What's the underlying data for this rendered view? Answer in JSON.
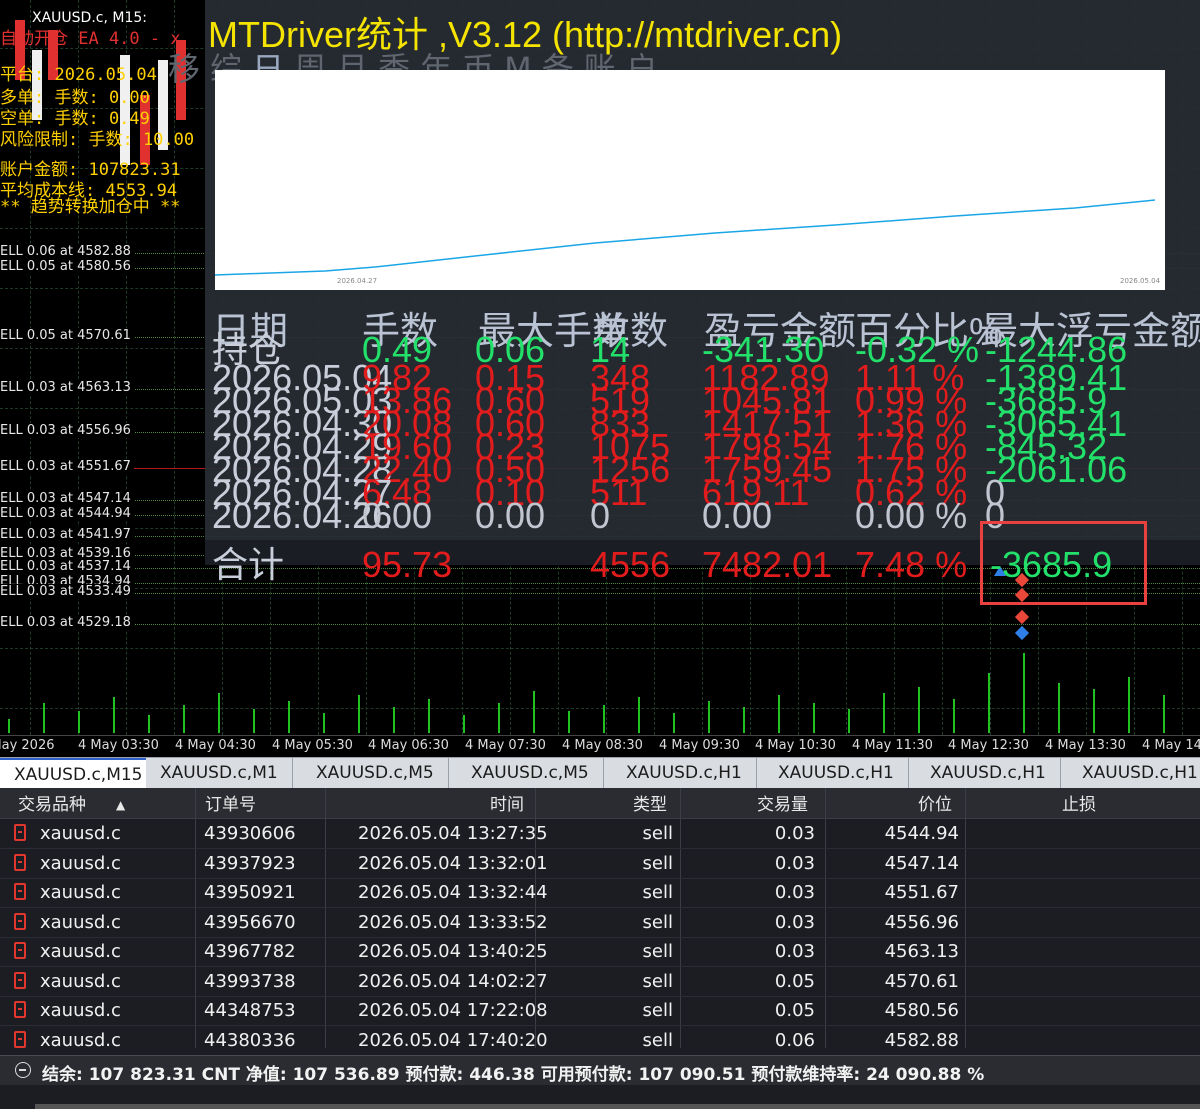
{
  "chart": {
    "symbol_title": "XAUUSD.c, M15:",
    "ea_lines": [
      "自动开仓  EA 4.0 - x",
      "平台: 2026.05.04",
      "多单: 手数: 0.00",
      "空单: 手数: 0.49",
      "风险限制: 手数: 10.00",
      "账户金额: 107823.31",
      "平均成本线: 4553.94",
      "** 趋势转换加仓中 **"
    ],
    "levels": [
      {
        "label": "ELL 0.06 at 4582.88"
      },
      {
        "label": "ELL 0.05 at 4580.56"
      },
      {
        "label": "ELL 0.05 at 4570.61"
      },
      {
        "label": "ELL 0.03 at 4563.13"
      },
      {
        "label": "ELL 0.03 at 4556.96"
      },
      {
        "label": "ELL 0.03 at 4551.67"
      },
      {
        "label": "ELL 0.03 at 4547.14"
      },
      {
        "label": "ELL 0.03 at 4544.94"
      },
      {
        "label": "ELL 0.03 at 4541.97"
      },
      {
        "label": "ELL 0.03 at 4539.16"
      },
      {
        "label": "ELL 0.03 at 4537.14"
      },
      {
        "label": "ELL 0.03 at 4534.94"
      },
      {
        "label": "ELL 0.03 at 4533.49"
      },
      {
        "label": "ELL 0.03 at 4529.18"
      }
    ],
    "time_labels": [
      "lay 2026",
      "4 May 03:30",
      "4 May 04:30",
      "4 May 05:30",
      "4 May 06:30",
      "4 May 07:30",
      "4 May 08:30",
      "4 May 09:30",
      "4 May 10:30",
      "4 May 11:30",
      "4 May 12:30",
      "4 May 13:30",
      "4 May 14"
    ]
  },
  "overlay": {
    "title": "MTDriver统计 ,V3.12 (http://mtdriver.cn)",
    "tabs": [
      "移",
      "综",
      "日",
      "周",
      "月",
      "季",
      "年",
      "币",
      "M",
      "备",
      "账",
      "户"
    ],
    "active_tab": "日",
    "equity_dates": [
      "2026.04.27",
      "2026.05.04"
    ],
    "colors": {
      "equity_line": "#1aa6e6",
      "positive": "#22e06a",
      "negative": "#e21c1c"
    },
    "headers": [
      "日期",
      "手数",
      "最大手数",
      "单数",
      "盈亏金额",
      "百分比%",
      "最大浮亏金额"
    ],
    "holding_row": {
      "label": "持仓",
      "lots": "0.49",
      "max_lots": "0.06",
      "count": "14",
      "pnl": "-341.30",
      "pct": "-0.32 %",
      "max_float_loss": "-1244.86"
    },
    "rows": [
      {
        "date": "2026.05.04",
        "lots": "9.82",
        "max_lots": "0.15",
        "count": "348",
        "pnl": "1182.89",
        "pct": "1.11 %",
        "max_float_loss": "-1389.41"
      },
      {
        "date": "2026.05.03",
        "lots": "13.86",
        "max_lots": "0.60",
        "count": "519",
        "pnl": "1045.81",
        "pct": "0.99 %",
        "max_float_loss": "-3685.9"
      },
      {
        "date": "2026.04.30",
        "lots": "20.08",
        "max_lots": "0.60",
        "count": "833",
        "pnl": "1417.51",
        "pct": "1.36 %",
        "max_float_loss": "-3065.41"
      },
      {
        "date": "2026.04.29",
        "lots": "19.60",
        "max_lots": "0.23",
        "count": "1075",
        "pnl": "1798.54",
        "pct": "1.76 %",
        "max_float_loss": "-845.32"
      },
      {
        "date": "2026.04.28",
        "lots": "22.40",
        "max_lots": "0.50",
        "count": "1256",
        "pnl": "1759.45",
        "pct": "1.75 %",
        "max_float_loss": "-2061.06"
      },
      {
        "date": "2026.04.27",
        "lots": "6.48",
        "max_lots": "0.10",
        "count": "511",
        "pnl": "619.11",
        "pct": "0.62 %",
        "max_float_loss": "0"
      },
      {
        "date": "2026.04.26",
        "lots": "0.00",
        "max_lots": "0.00",
        "count": "0",
        "pnl": "0.00",
        "pct": "0.00 %",
        "max_float_loss": "0"
      }
    ],
    "total": {
      "label": "合计",
      "lots": "95.73",
      "count": "4556",
      "pnl": "7482.01",
      "pct": "7.48 %",
      "max_float_loss": "-3685.9"
    }
  },
  "tabs": [
    "XAUUSD.c,M15",
    "XAUUSD.c,M1",
    "XAUUSD.c,M5",
    "XAUUSD.c,M5",
    "XAUUSD.c,H1",
    "XAUUSD.c,H1",
    "XAUUSD.c,H1",
    "XAUUSD.c,H1"
  ],
  "trade_table": {
    "columns": [
      "交易品种",
      "订单号",
      "时间",
      "类型",
      "交易量",
      "价位",
      "止损"
    ],
    "sort_icon": "sort-ascending-icon",
    "rows": [
      {
        "symbol": "xauusd.c",
        "order": "43930606",
        "time": "2026.05.04 13:27:35",
        "type": "sell",
        "volume": "0.03",
        "price": "4544.94"
      },
      {
        "symbol": "xauusd.c",
        "order": "43937923",
        "time": "2026.05.04 13:32:01",
        "type": "sell",
        "volume": "0.03",
        "price": "4547.14"
      },
      {
        "symbol": "xauusd.c",
        "order": "43950921",
        "time": "2026.05.04 13:32:44",
        "type": "sell",
        "volume": "0.03",
        "price": "4551.67"
      },
      {
        "symbol": "xauusd.c",
        "order": "43956670",
        "time": "2026.05.04 13:33:52",
        "type": "sell",
        "volume": "0.03",
        "price": "4556.96"
      },
      {
        "symbol": "xauusd.c",
        "order": "43967782",
        "time": "2026.05.04 13:40:25",
        "type": "sell",
        "volume": "0.03",
        "price": "4563.13"
      },
      {
        "symbol": "xauusd.c",
        "order": "43993738",
        "time": "2026.05.04 14:02:27",
        "type": "sell",
        "volume": "0.05",
        "price": "4570.61"
      },
      {
        "symbol": "xauusd.c",
        "order": "44348753",
        "time": "2026.05.04 17:22:08",
        "type": "sell",
        "volume": "0.05",
        "price": "4580.56"
      },
      {
        "symbol": "xauusd.c",
        "order": "44380336",
        "time": "2026.05.04 17:40:20",
        "type": "sell",
        "volume": "0.06",
        "price": "4582.88"
      }
    ]
  },
  "summary": "结余: 107 823.31 CNT  净值: 107 536.89  预付款: 446.38  可用预付款: 107 090.51  预付款维持率: 24 090.88 %"
}
